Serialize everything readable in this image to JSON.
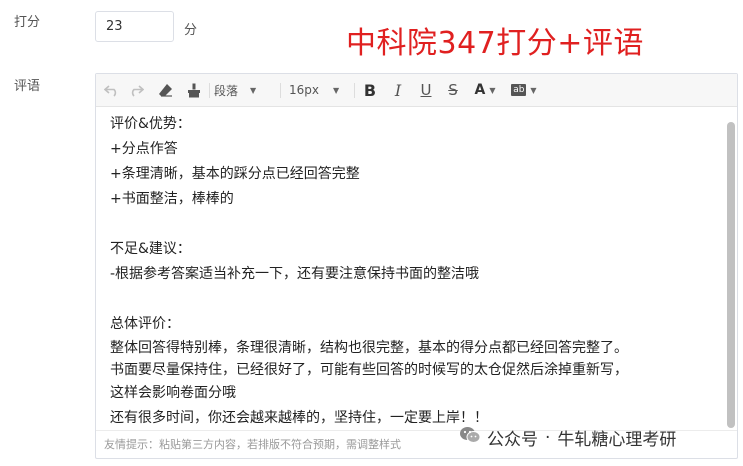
{
  "form": {
    "score_label": "打分",
    "score_value": "23",
    "score_unit": "分",
    "comment_label": "评语"
  },
  "headline": "中科院347打分+评语",
  "toolbar": {
    "paragraph": "段落",
    "font_size": "16px",
    "bold": "B",
    "italic": "I",
    "underline": "U",
    "strike": "S",
    "font_color": "A",
    "bg_color": "ab",
    "icons": [
      "undo-icon",
      "redo-icon",
      "eraser-icon",
      "format-brush-icon",
      "chevron-down-icon"
    ]
  },
  "content": {
    "lines": [
      "评价&优势：",
      "+分点作答",
      "+条理清晰，基本的踩分点已经回答完整",
      "+书面整洁，棒棒的",
      "",
      "不足&建议：",
      "-根据参考答案适当补充一下，还有要注意保持书面的整洁哦",
      "",
      "总体评价：",
      "整体回答得特别棒，条理很清晰，结构也很完整，基本的得分点都已经回答完整了。",
      "书面要尽量保持住，已经很好了，可能有些回答的时候写的太仓促然后涂掉重新写，",
      "这样会影响卷面分哦",
      "还有很多时间，你还会越来越棒的，坚持住，一定要上岸！！"
    ]
  },
  "footer": {
    "hint": "友情提示：粘贴第三方内容，若排版不符合预期，需调整样式"
  },
  "watermark": {
    "prefix": "公众号",
    "dot": "·",
    "name": "牛轧糖心理考研"
  },
  "colors": {
    "headline": "#e02020",
    "border": "#dcdfe6",
    "toolbar_bg": "#f7f7f7"
  }
}
